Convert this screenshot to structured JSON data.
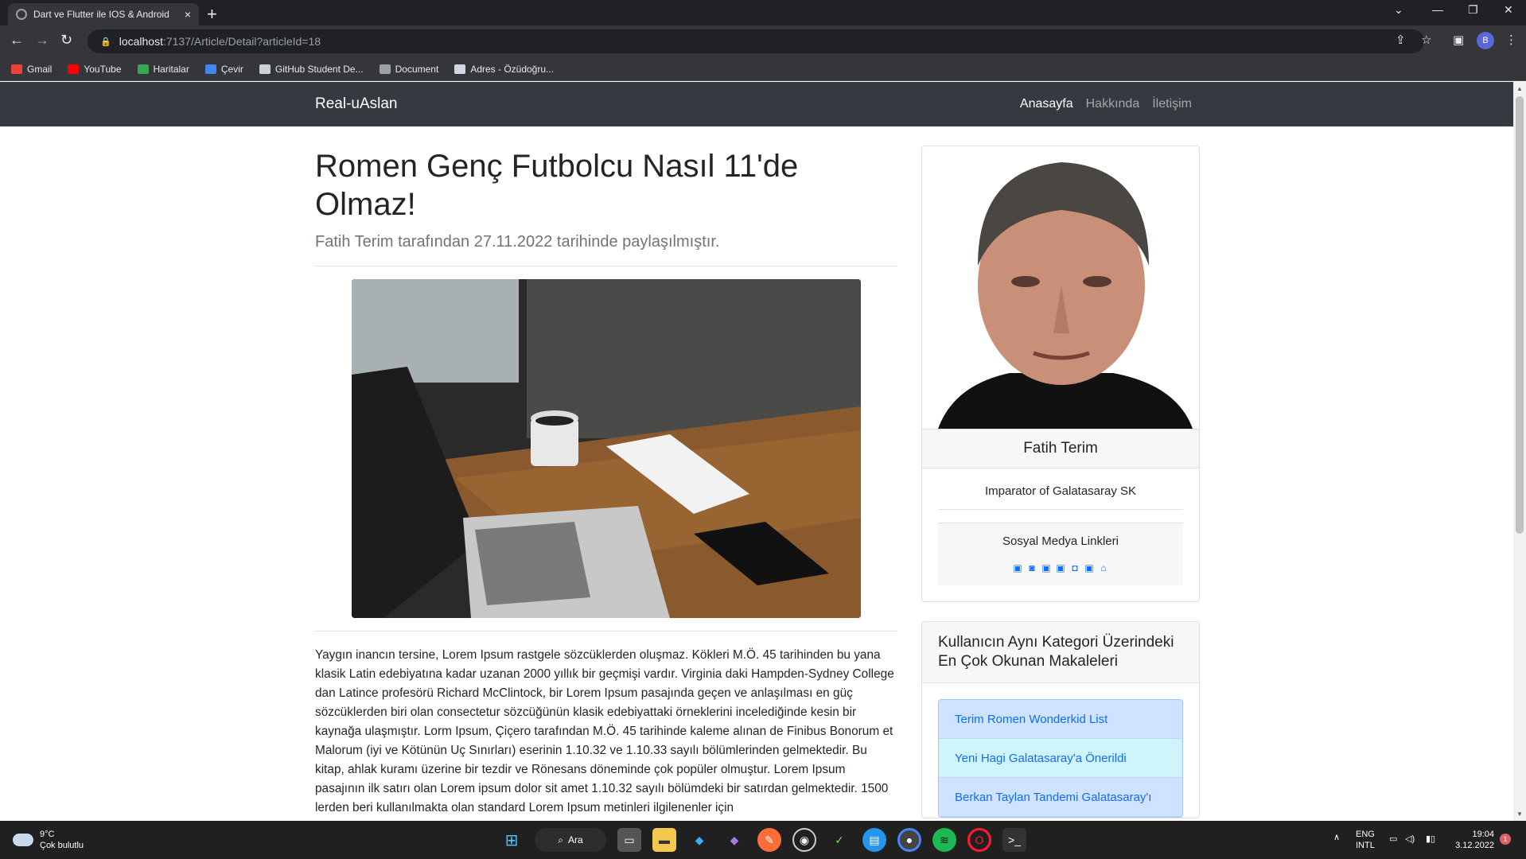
{
  "browser": {
    "tab_title": "Dart ve Flutter ile IOS & Android",
    "tab_close": "×",
    "new_tab": "+",
    "url_host": "localhost",
    "url_path": ":7137/Article/Detail?articleId=18",
    "profile_initial": "B",
    "bookmarks": [
      {
        "label": "Gmail",
        "color": "#ea4335"
      },
      {
        "label": "YouTube",
        "color": "#ff0000"
      },
      {
        "label": "Haritalar",
        "color": "#34a853"
      },
      {
        "label": "Çevir",
        "color": "#4285f4"
      },
      {
        "label": "GitHub Student De...",
        "color": "#c9d1d9"
      },
      {
        "label": "Document",
        "color": "#9aa0a6"
      },
      {
        "label": "Adres - Özüdoğru...",
        "color": "#cfd8e3"
      }
    ]
  },
  "site": {
    "brand": "Real-uAslan",
    "nav": [
      "Anasayfa",
      "Hakkında",
      "İletişim"
    ]
  },
  "article": {
    "title": "Romen Genç Futbolcu Nasıl 11'de Olmaz!",
    "meta": "Fatih Terim tarafından 27.11.2022 tarihinde paylaşılmıştır.",
    "body": "Yaygın inancın tersine, Lorem Ipsum rastgele sözcüklerden oluşmaz. Kökleri M.Ö. 45 tarihinden bu yana klasik Latin edebiyatına kadar uzanan 2000 yıllık bir geçmişi vardır. Virginia daki Hampden-Sydney College dan Latince profesörü Richard McClintock, bir Lorem Ipsum pasajında geçen ve anlaşılması en güç sözcüklerden biri olan consectetur sözcüğünün klasik edebiyattaki örneklerini incelediğinde kesin bir kaynağa ulaşmıştır. Lorm Ipsum, Çiçero tarafından M.Ö. 45 tarihinde kaleme alınan de Finibus Bonorum et Malorum (iyi ve Kötünün Uç Sınırları) eserinin 1.10.32 ve 1.10.33 sayılı bölümlerinden gelmektedir. Bu kitap, ahlak kuramı üzerine bir tezdir ve Rönesans döneminde çok popüler olmuştur. Lorem Ipsum pasajının ilk satırı olan Lorem ipsum dolor sit amet 1.10.32 sayılı bölümdeki bir satırdan gelmektedir. 1500 lerden beri kullanılmakta olan standard Lorem Ipsum metinleri ilgilenenler için"
  },
  "author": {
    "name": "Fatih Terim",
    "bio": "Imparator of Galatasaray SK",
    "social_title": "Sosyal Medya Linkleri",
    "social_icons": [
      "linkedin-icon",
      "github-icon",
      "twitter-icon",
      "facebook-icon",
      "instagram-icon",
      "youtube-icon",
      "home-icon"
    ]
  },
  "popular": {
    "header": "Kullanıcın Aynı Kategori Üzerindeki En Çok Okunan Makaleleri",
    "items": [
      {
        "label": "Terim Romen Wonderkid List",
        "style": "blue"
      },
      {
        "label": "Yeni Hagi Galatasaray'a Önerildi",
        "style": "cyan"
      },
      {
        "label": "Berkan Taylan Tandemi Galatasaray'ı",
        "style": "blue"
      }
    ]
  },
  "taskbar": {
    "temp": "9°C",
    "weather": "Çok bulutlu",
    "search": "Ara",
    "lang1": "ENG",
    "lang2": "INTL",
    "time": "19:04",
    "date": "3.12.2022",
    "notif": "1"
  }
}
